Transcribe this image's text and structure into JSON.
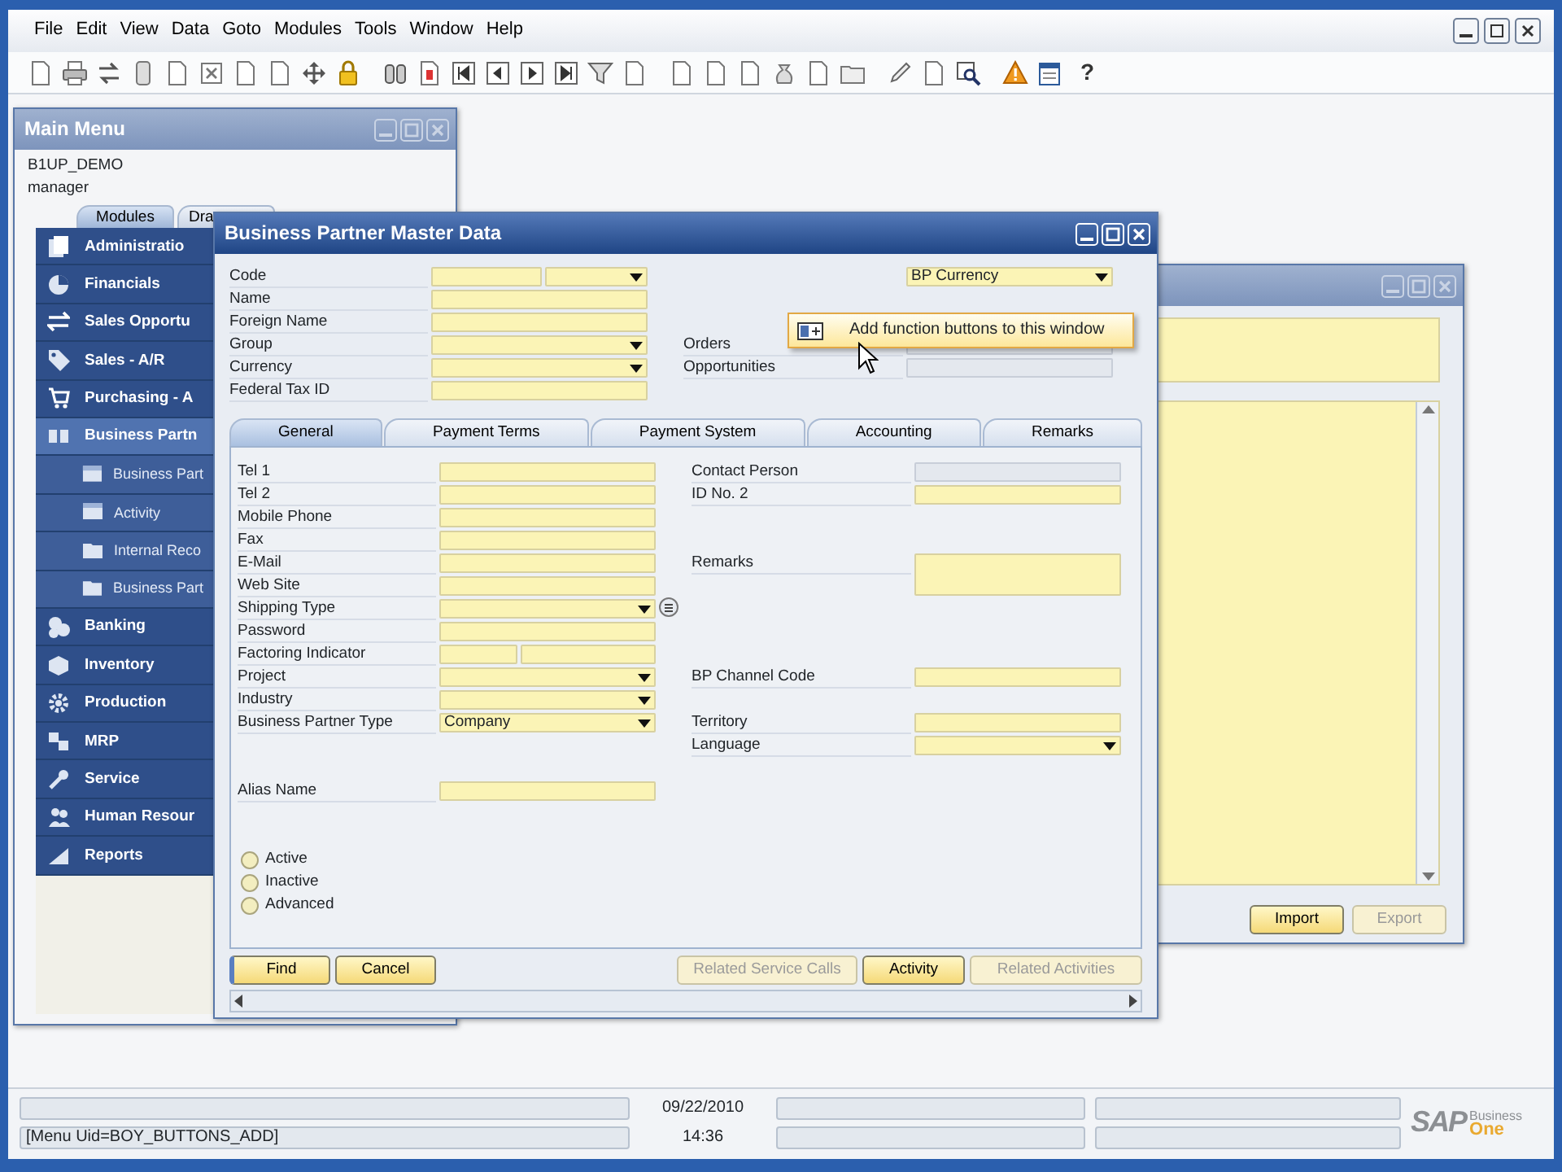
{
  "menu_bar": {
    "items": [
      "File",
      "Edit",
      "View",
      "Data",
      "Goto",
      "Modules",
      "Tools",
      "Window",
      "Help"
    ]
  },
  "toolbar": {
    "help_glyph": "?"
  },
  "main_menu": {
    "title": "Main Menu",
    "company": "B1UP_DEMO",
    "user": "manager",
    "tabs": [
      {
        "label": "Modules",
        "selected": true
      },
      {
        "label": "Dra",
        "selected": false
      }
    ],
    "items": [
      {
        "label": "Administratio",
        "kind": "module",
        "selected": false
      },
      {
        "label": "Financials",
        "kind": "module",
        "selected": false
      },
      {
        "label": "Sales Opportu",
        "kind": "module",
        "selected": false
      },
      {
        "label": "Sales - A/R",
        "kind": "module",
        "selected": false
      },
      {
        "label": "Purchasing - A",
        "kind": "module",
        "selected": false
      },
      {
        "label": "Business Partn",
        "kind": "module",
        "selected": true
      },
      {
        "label": "Business Part",
        "kind": "sub",
        "selected": false
      },
      {
        "label": "Activity",
        "kind": "sub",
        "selected": false
      },
      {
        "label": "Internal Reco",
        "kind": "sub",
        "selected": false
      },
      {
        "label": "Business Part",
        "kind": "sub",
        "selected": false
      },
      {
        "label": "Banking",
        "kind": "module",
        "selected": false
      },
      {
        "label": "Inventory",
        "kind": "module",
        "selected": false
      },
      {
        "label": "Production",
        "kind": "module",
        "selected": false
      },
      {
        "label": "MRP",
        "kind": "module",
        "selected": false
      },
      {
        "label": "Service",
        "kind": "module",
        "selected": false
      },
      {
        "label": "Human Resour",
        "kind": "module",
        "selected": false
      },
      {
        "label": "Reports",
        "kind": "module",
        "selected": false
      }
    ]
  },
  "bp_window": {
    "title": "Business Partner Master Data",
    "header_left": [
      {
        "label": "Code",
        "kind": "split_dropdown"
      },
      {
        "label": "Name",
        "kind": "text"
      },
      {
        "label": "Foreign Name",
        "kind": "text"
      },
      {
        "label": "Group",
        "kind": "dropdown"
      },
      {
        "label": "Currency",
        "kind": "dropdown"
      },
      {
        "label": "Federal Tax ID",
        "kind": "text"
      }
    ],
    "header_right": [
      {
        "kind": "dropdown",
        "value": "BP Currency"
      },
      {
        "label": "Orders",
        "kind": "readonly"
      },
      {
        "label": "Opportunities",
        "kind": "readonly"
      }
    ],
    "tabs": [
      {
        "label": "General",
        "selected": true
      },
      {
        "label": "Payment Terms",
        "selected": false
      },
      {
        "label": "Payment System",
        "selected": false
      },
      {
        "label": "Accounting",
        "selected": false
      },
      {
        "label": "Remarks",
        "selected": false
      }
    ],
    "general_left": [
      {
        "label": "Tel 1",
        "kind": "text"
      },
      {
        "label": "Tel 2",
        "kind": "text"
      },
      {
        "label": "Mobile Phone",
        "kind": "text"
      },
      {
        "label": "Fax",
        "kind": "text"
      },
      {
        "label": "E-Mail",
        "kind": "text"
      },
      {
        "label": "Web Site",
        "kind": "text"
      },
      {
        "label": "Shipping Type",
        "kind": "dropdown_button"
      },
      {
        "label": "Password",
        "kind": "text"
      },
      {
        "label": "Factoring Indicator",
        "kind": "split"
      },
      {
        "label": "Project",
        "kind": "dropdown"
      },
      {
        "label": "Industry",
        "kind": "dropdown"
      },
      {
        "label": "Business Partner Type",
        "kind": "dropdown",
        "value": "Company"
      },
      {
        "label": "Alias Name",
        "kind": "text"
      }
    ],
    "general_right": [
      {
        "label": "Contact Person",
        "kind": "readonly"
      },
      {
        "label": "ID No. 2",
        "kind": "text"
      },
      {
        "label": "Remarks",
        "kind": "area"
      },
      {
        "label": "BP Channel Code",
        "kind": "text"
      },
      {
        "label": "Territory",
        "kind": "text"
      },
      {
        "label": "Language",
        "kind": "dropdown"
      }
    ],
    "status_radios": [
      {
        "label": "Active",
        "selected": false
      },
      {
        "label": "Inactive",
        "selected": false
      },
      {
        "label": "Advanced",
        "selected": false
      }
    ],
    "buttons_left": [
      {
        "label": "Find",
        "disabled": false
      },
      {
        "label": "Cancel",
        "disabled": false
      }
    ],
    "buttons_right": [
      {
        "label": "Related Service Calls",
        "disabled": true
      },
      {
        "label": "Activity",
        "disabled": false
      },
      {
        "label": "Related Activities",
        "disabled": true
      }
    ]
  },
  "background_window": {
    "buttons": [
      {
        "label": "Import",
        "disabled": false
      },
      {
        "label": "Export",
        "disabled": true
      }
    ]
  },
  "tooltip": {
    "text": "Add function buttons to this window"
  },
  "status_bar": {
    "message": "[Menu Uid=BOY_BUTTONS_ADD]",
    "date": "09/22/2010",
    "time": "14:36"
  },
  "logo": {
    "brand": "SAP",
    "line1": "Business",
    "line2": "One"
  }
}
